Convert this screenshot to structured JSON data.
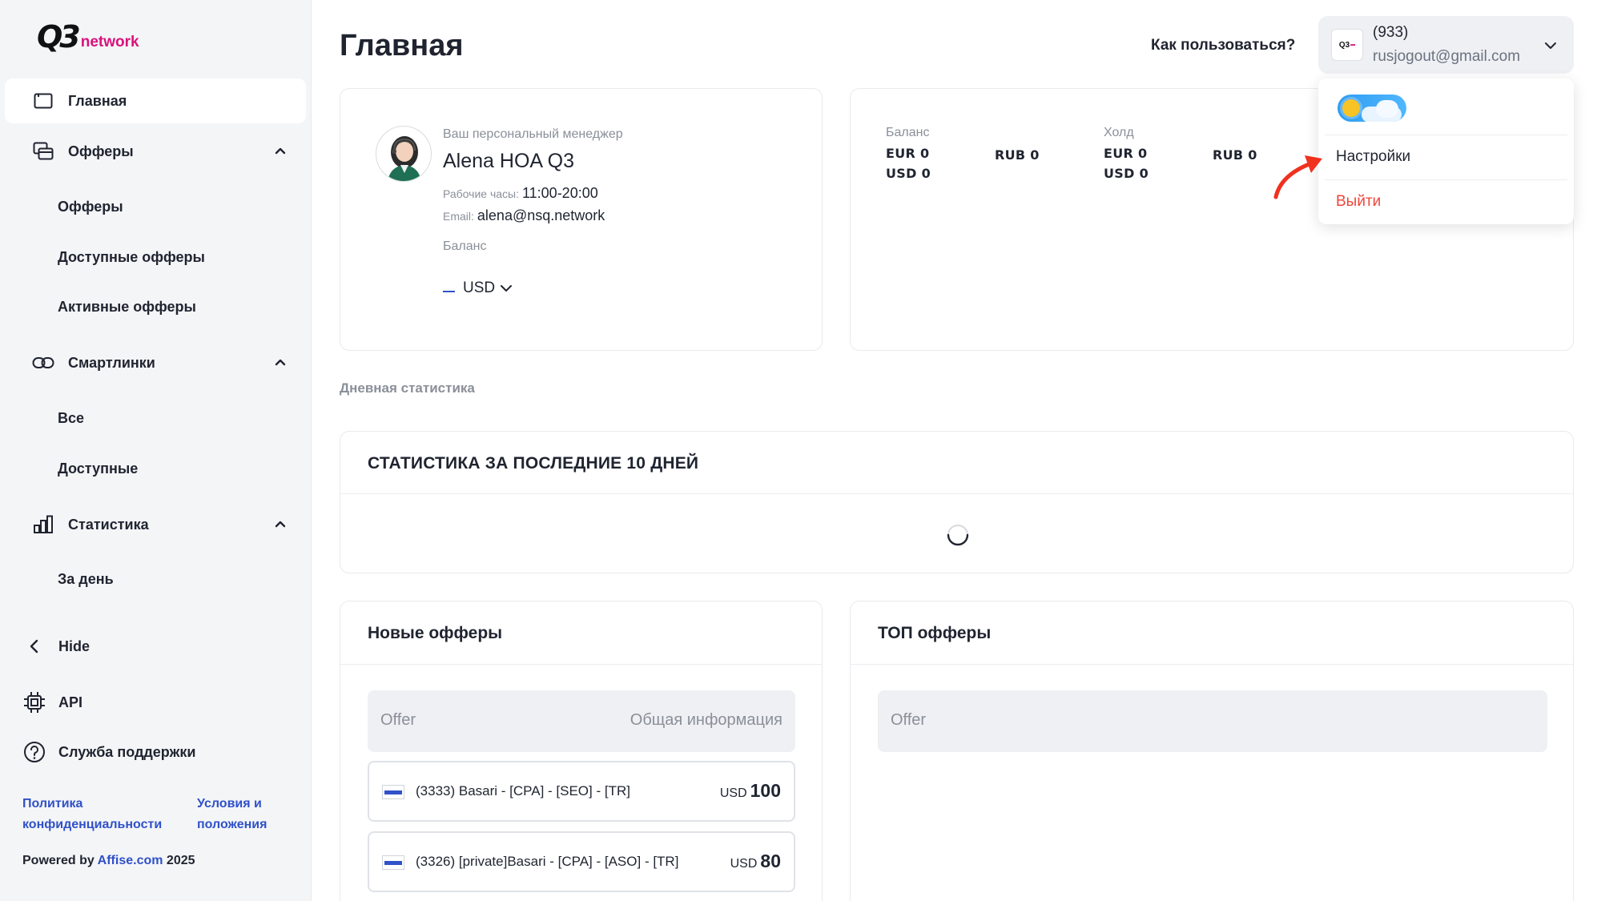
{
  "brand": {
    "mark": "Q3",
    "name": "network"
  },
  "sidebar": {
    "items": [
      {
        "label": "Главная"
      },
      {
        "label": "Офферы",
        "sub": [
          "Офферы",
          "Доступные офферы",
          "Активные офферы"
        ]
      },
      {
        "label": "Смартлинки",
        "sub": [
          "Все",
          "Доступные"
        ]
      },
      {
        "label": "Статистика",
        "sub": [
          "За день"
        ]
      }
    ],
    "hide": "Hide",
    "api": "API",
    "support": "Служба поддержки",
    "privacy": "Политика конфиденциальности",
    "terms": "Условия и положения",
    "powered_prefix": "Powered by",
    "powered_link": "Affise.com",
    "powered_year": "2025"
  },
  "header": {
    "title": "Главная",
    "howto": "Как пользоваться?",
    "account_id": "(933)",
    "account_email": "rusjogout@gmail.com",
    "avatar_mark": "Q3"
  },
  "dropdown": {
    "settings": "Настройки",
    "logout": "Выйти"
  },
  "manager": {
    "label": "Ваш персональный менеджер",
    "name": "Alena HOA Q3",
    "hours_label": "Рабочие часы:",
    "hours": "11:00-20:00",
    "email_label": "Email:",
    "email": "alena@nsq.network",
    "balance_label": "Баланс",
    "currency": "USD"
  },
  "balance": {
    "balance_label": "Баланс",
    "hold_label": "Холд",
    "balance_lines_a": [
      "EUR 0",
      "USD 0"
    ],
    "balance_lines_b": [
      "RUB 0"
    ],
    "hold_lines_a": [
      "EUR 0",
      "USD 0"
    ],
    "hold_lines_b": [
      "RUB 0"
    ]
  },
  "daily_stats_label": "Дневная статистика",
  "stats": {
    "title": "СТАТИСТИКА ЗА ПОСЛЕДНИЕ 10 ДНЕЙ"
  },
  "new_offers": {
    "title": "Новые офферы",
    "col_offer": "Offer",
    "col_info": "Общая информация",
    "rows": [
      {
        "name": "(3333) Basari - [CPA] - [SEO] - [TR]",
        "currency": "USD",
        "amount": "100"
      },
      {
        "name": "(3326) [private]Basari - [CPA] - [ASO] - [TR]",
        "currency": "USD",
        "amount": "80"
      }
    ]
  },
  "top_offers": {
    "title": "ТОП офферы",
    "col_offer": "Offer"
  },
  "colors": {
    "accent": "#2f51c9",
    "brand": "#d9127b",
    "danger": "#f0453a"
  }
}
